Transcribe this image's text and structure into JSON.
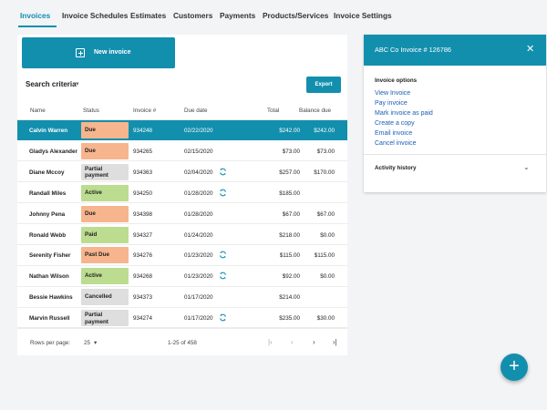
{
  "tabs": [
    {
      "label": "Invoices",
      "active": true
    },
    {
      "label": "Invoice Schedules"
    },
    {
      "label": "Estimates"
    },
    {
      "label": "Customers"
    },
    {
      "label": "Payments"
    },
    {
      "label": "Products/Services"
    },
    {
      "label": "Invoice Settings"
    }
  ],
  "toolbar": {
    "new_invoice_label": "New invoice",
    "search_criteria_label": "Search criteria",
    "export_label": "Export"
  },
  "table": {
    "columns": [
      "Name",
      "Status",
      "Invoice #",
      "Due date",
      "Total",
      "Balance due"
    ],
    "rows": [
      {
        "name": "Calvin Warren",
        "status": "Due",
        "status_kind": "due",
        "invoice": "934248",
        "due_date": "02/22/2020",
        "synced": false,
        "total": "$242.00",
        "balance": "$242.00",
        "selected": true
      },
      {
        "name": "Gladys Alexander",
        "status": "Due",
        "status_kind": "due",
        "invoice": "934265",
        "due_date": "02/15/2020",
        "synced": false,
        "total": "$73.00",
        "balance": "$73.00"
      },
      {
        "name": "Diane Mccoy",
        "status": "Partial payment",
        "status_kind": "partial",
        "invoice": "934363",
        "due_date": "02/04/2020",
        "synced": true,
        "total": "$257.00",
        "balance": "$170.00"
      },
      {
        "name": "Randall Miles",
        "status": "Active",
        "status_kind": "active",
        "invoice": "934250",
        "due_date": "01/28/2020",
        "synced": true,
        "total": "$185.00",
        "balance": ""
      },
      {
        "name": "Johnny Pena",
        "status": "Due",
        "status_kind": "due",
        "invoice": "934398",
        "due_date": "01/28/2020",
        "synced": false,
        "total": "$67.00",
        "balance": "$67.00"
      },
      {
        "name": "Ronald Webb",
        "status": "Paid",
        "status_kind": "paid",
        "invoice": "934327",
        "due_date": "01/24/2020",
        "synced": false,
        "total": "$218.00",
        "balance": "$0.00"
      },
      {
        "name": "Serenity Fisher",
        "status": "Past Due",
        "status_kind": "pastdue",
        "invoice": "934276",
        "due_date": "01/23/2020",
        "synced": true,
        "total": "$115.00",
        "balance": "$115.00"
      },
      {
        "name": "Nathan Wilson",
        "status": "Active",
        "status_kind": "active",
        "invoice": "934268",
        "due_date": "01/23/2020",
        "synced": true,
        "total": "$92.00",
        "balance": "$0.00"
      },
      {
        "name": "Bessie Hawkins",
        "status": "Cancelled",
        "status_kind": "cancelled",
        "invoice": "934373",
        "due_date": "01/17/2020",
        "synced": false,
        "total": "$214.00",
        "balance": ""
      },
      {
        "name": "Marvin Russell",
        "status": "Partial payment",
        "status_kind": "partial",
        "invoice": "934274",
        "due_date": "01/17/2020",
        "synced": true,
        "total": "$235.00",
        "balance": "$30.00"
      }
    ]
  },
  "footer": {
    "rows_per_page_label": "Rows per page:",
    "rows_per_page_value": "25",
    "range_text": "1-25 of 458"
  },
  "panel": {
    "title": "ABC Co Invoice # 126786",
    "options_heading": "Invoice options",
    "options": [
      "View Invoice",
      "Pay invoice",
      "Mark invoice as paid",
      "Create a copy",
      "Email invoice",
      "Cancel invoice"
    ],
    "activity_label": "Activity history"
  },
  "colors": {
    "accent": "#138fae",
    "due": "#f7b58e",
    "pastdue": "#f7b58e",
    "active": "#bcdc8f",
    "paid": "#bcdc8f",
    "partial": "#dedede",
    "cancelled": "#dedede",
    "link": "#1a5fb4"
  },
  "icons": {
    "sync": "sync-icon",
    "fab": "add-icon"
  }
}
